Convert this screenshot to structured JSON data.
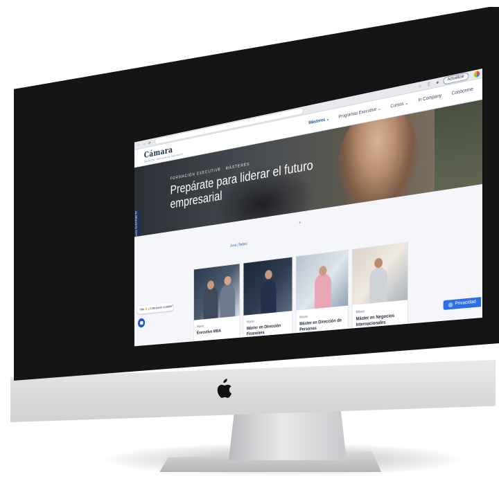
{
  "browser": {
    "update_label": "Actualizar"
  },
  "site": {
    "logo": "Cámara",
    "logo_tag": "VALENCIA · ESCUELA DE NEGOCIOS",
    "nav": [
      {
        "label": "Másteres ⌄",
        "active": true
      },
      {
        "label": "Programas Executive ⌄",
        "active": false
      },
      {
        "label": "Cursos ⌄",
        "active": false
      },
      {
        "label": "In Company",
        "active": false
      },
      {
        "label": "Conóceme",
        "active": false
      }
    ]
  },
  "hero": {
    "eyebrow": "FORMACIÓN EXECUTIVE · MÁSTERES",
    "title": "Prepárate para liderar el futuro empresarial"
  },
  "sidebar_tab": {
    "label": "Newsletter Formación SUSCRÍBETE"
  },
  "content": {
    "area_filter": "Área (Todas)",
    "cards": [
      {
        "kind": "Máster",
        "title": "Executive MBA"
      },
      {
        "kind": "Máster",
        "title": "Máster en Dirección Financiera"
      },
      {
        "kind": "Máster",
        "title": "Máster en Dirección de Personas"
      },
      {
        "kind": "Máster",
        "title": "Máster en Negocios Internacionales"
      }
    ]
  },
  "chat": {
    "prompt": "Hola 👋 ¿Cómo puedo ayudarte?"
  },
  "privacy": {
    "label": "Privacidad"
  },
  "icons": [
    "back-arrow-icon",
    "forward-arrow-icon",
    "reload-icon",
    "star-icon",
    "share-icon",
    "profile-icon",
    "browser-ext-icon",
    "mail-icon",
    "chat-icon",
    "apple-logo-icon"
  ]
}
